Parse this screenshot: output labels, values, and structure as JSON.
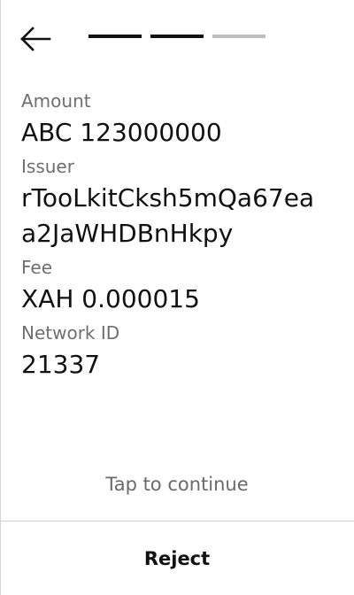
{
  "header": {
    "back_icon": "arrow-left-icon",
    "steps": [
      {
        "state": "complete",
        "color": "#111111"
      },
      {
        "state": "complete",
        "color": "#111111"
      },
      {
        "state": "pending",
        "color": "#bdbdbd"
      }
    ]
  },
  "fields": {
    "amount": {
      "label": "Amount",
      "value": "ABC 123000000"
    },
    "issuer": {
      "label": "Issuer",
      "value": "rTooLkitCksh5mQa67eaa2JaWHDBnHkpy"
    },
    "fee": {
      "label": "Fee",
      "value": "XAH 0.000015"
    },
    "network_id": {
      "label": "Network ID",
      "value": "21337"
    }
  },
  "actions": {
    "tap_continue": "Tap to continue",
    "reject": "Reject"
  }
}
